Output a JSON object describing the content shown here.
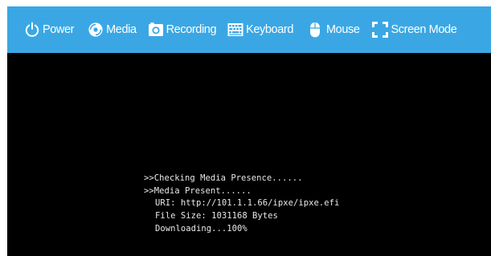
{
  "toolbar": {
    "background_color": "#3aa7e4",
    "items": [
      {
        "label": "Power",
        "icon": "power-icon"
      },
      {
        "label": "Media",
        "icon": "media-disc-icon"
      },
      {
        "label": "Recording",
        "icon": "camera-icon"
      },
      {
        "label": "Keyboard",
        "icon": "keyboard-icon"
      },
      {
        "label": "Mouse",
        "icon": "mouse-icon"
      },
      {
        "label": "Screen Mode",
        "icon": "fullscreen-icon"
      }
    ]
  },
  "console": {
    "background_color": "#000000",
    "text_color": "#e8e8e8",
    "lines": [
      ">>Checking Media Presence......",
      ">>Media Present......",
      "URI: http://101.1.1.66/ipxe/ipxe.efi",
      "File Size: 1031168 Bytes",
      "Downloading...100%"
    ]
  }
}
